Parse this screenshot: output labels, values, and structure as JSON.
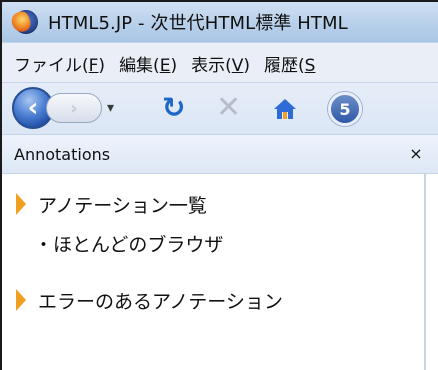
{
  "window": {
    "title": "HTML5.JP - 次世代HTML標準 HTML"
  },
  "menubar": {
    "items": [
      {
        "label": "ファイル(F)",
        "mnemonic": "F"
      },
      {
        "label": "編集(E)",
        "mnemonic": "E"
      },
      {
        "label": "表示(V)",
        "mnemonic": "V"
      },
      {
        "label": "履歴(S",
        "mnemonic": "S"
      }
    ]
  },
  "navbar": {
    "back_icon": "back-icon",
    "forward_icon": "forward-icon",
    "reload_icon": "reload-icon",
    "stop_icon": "stop-icon",
    "home_icon": "home-icon",
    "html5_badge": "5"
  },
  "sidebar": {
    "title": "Annotations",
    "close_label": "×",
    "tree": [
      {
        "label": "アノテーション一覧",
        "type": "group"
      },
      {
        "label": "・ほとんどのブラウザ",
        "type": "child"
      },
      {
        "label": "エラーのあるアノテーション",
        "type": "group"
      }
    ]
  },
  "colors": {
    "accent": "#2f58a8",
    "reload": "#1f67c6",
    "twisty": "#f0a020",
    "menubar_bg": "#e9eef7"
  }
}
